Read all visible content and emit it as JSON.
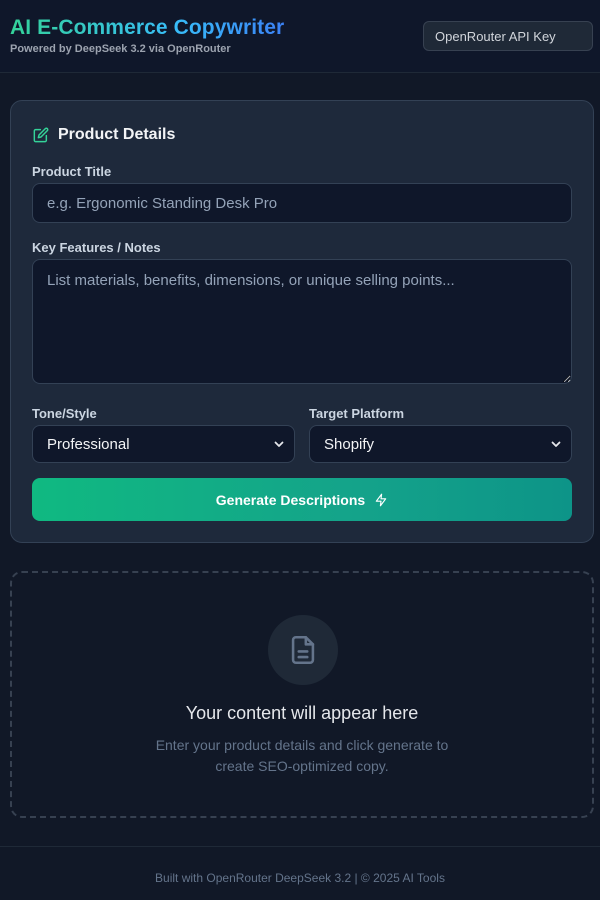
{
  "header": {
    "title": "AI E-Commerce Copywriter",
    "subtitle": "Powered by DeepSeek 3.2 via OpenRouter",
    "api_key_placeholder": "OpenRouter API Key"
  },
  "form": {
    "heading": "Product Details",
    "product_title": {
      "label": "Product Title",
      "placeholder": "e.g. Ergonomic Standing Desk Pro",
      "value": ""
    },
    "features": {
      "label": "Key Features / Notes",
      "placeholder": "List materials, benefits, dimensions, or unique selling points...",
      "value": ""
    },
    "tone": {
      "label": "Tone/Style",
      "selected": "Professional"
    },
    "platform": {
      "label": "Target Platform",
      "selected": "Shopify"
    },
    "generate_label": "Generate Descriptions"
  },
  "output": {
    "title": "Your content will appear here",
    "desc_line1": "Enter your product details and click generate to",
    "desc_line2": "create SEO-optimized copy."
  },
  "footer": {
    "text": "Built with OpenRouter DeepSeek 3.2 | © 2025 AI Tools"
  },
  "colors": {
    "accent_green": "#10b981",
    "accent_teal": "#0d9488",
    "background": "#111827",
    "card": "#1e293b"
  },
  "icons": [
    "edit-icon",
    "bolt-icon",
    "document-icon",
    "chevron-down-icon"
  ]
}
